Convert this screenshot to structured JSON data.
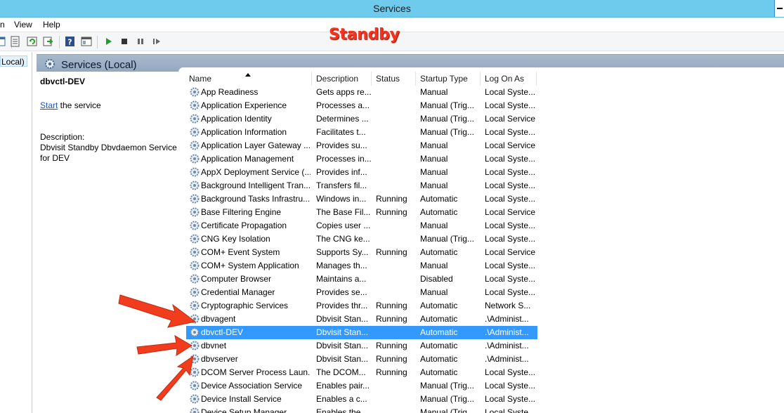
{
  "window": {
    "title": "Services"
  },
  "menu": {
    "items": [
      "n",
      "View",
      "Help"
    ]
  },
  "annotation": {
    "label": "Standby"
  },
  "tree": {
    "node_label": "Local)"
  },
  "pane": {
    "title": "Services (Local)"
  },
  "detail": {
    "service_name": "dbvctl-DEV",
    "start_link": "Start",
    "start_suffix": " the service",
    "description_label": "Description:",
    "description_text": "Dbvisit Standby Dbvdaemon Service for DEV"
  },
  "columns": [
    "Name",
    "Description",
    "Status",
    "Startup Type",
    "Log On As"
  ],
  "rows": [
    [
      "App Readiness",
      "Gets apps re...",
      "",
      "Manual",
      "Local Syste..."
    ],
    [
      "Application Experience",
      "Processes a...",
      "",
      "Manual (Trig...",
      "Local Syste..."
    ],
    [
      "Application Identity",
      "Determines ...",
      "",
      "Manual (Trig...",
      "Local Service"
    ],
    [
      "Application Information",
      "Facilitates t...",
      "",
      "Manual (Trig...",
      "Local Syste..."
    ],
    [
      "Application Layer Gateway ...",
      "Provides su...",
      "",
      "Manual",
      "Local Service"
    ],
    [
      "Application Management",
      "Processes in...",
      "",
      "Manual",
      "Local Syste..."
    ],
    [
      "AppX Deployment Service (...",
      "Provides inf...",
      "",
      "Manual",
      "Local Syste..."
    ],
    [
      "Background Intelligent Tran...",
      "Transfers fil...",
      "",
      "Manual",
      "Local Syste..."
    ],
    [
      "Background Tasks Infrastru...",
      "Windows in...",
      "Running",
      "Automatic",
      "Local Syste..."
    ],
    [
      "Base Filtering Engine",
      "The Base Fil...",
      "Running",
      "Automatic",
      "Local Service"
    ],
    [
      "Certificate Propagation",
      "Copies user ...",
      "",
      "Manual",
      "Local Syste..."
    ],
    [
      "CNG Key Isolation",
      "The CNG ke...",
      "",
      "Manual (Trig...",
      "Local Syste..."
    ],
    [
      "COM+ Event System",
      "Supports Sy...",
      "Running",
      "Automatic",
      "Local Service"
    ],
    [
      "COM+ System Application",
      "Manages th...",
      "",
      "Manual",
      "Local Syste..."
    ],
    [
      "Computer Browser",
      "Maintains a...",
      "",
      "Disabled",
      "Local Syste..."
    ],
    [
      "Credential Manager",
      "Provides se...",
      "",
      "Manual",
      "Local Syste..."
    ],
    [
      "Cryptographic Services",
      "Provides thr...",
      "Running",
      "Automatic",
      "Network S..."
    ],
    [
      "dbvagent",
      "Dbvisit Stan...",
      "Running",
      "Automatic",
      ".\\Administ..."
    ],
    [
      "dbvctl-DEV",
      "Dbvisit Stan...",
      "",
      "Automatic",
      ".\\Administ..."
    ],
    [
      "dbvnet",
      "Dbvisit Stan...",
      "Running",
      "Automatic",
      ".\\Administ..."
    ],
    [
      "dbvserver",
      "Dbvisit Stan...",
      "Running",
      "Automatic",
      ".\\Administ..."
    ],
    [
      "DCOM Server Process Laun...",
      "The DCOM...",
      "Running",
      "Automatic",
      "Local Syste..."
    ],
    [
      "Device Association Service",
      "Enables pair...",
      "",
      "Manual (Trig...",
      "Local Syste..."
    ],
    [
      "Device Install Service",
      "Enables a c...",
      "",
      "Manual (Trig...",
      "Local Syste..."
    ],
    [
      "Device Setup Manager",
      "Enables the ...",
      "",
      "Manual (Trig...",
      "Local Syste..."
    ]
  ],
  "selected_row": 18,
  "colors": {
    "selection": "#3399ff",
    "titlebar": "#6fcbed",
    "annotation": "#f4321e"
  }
}
